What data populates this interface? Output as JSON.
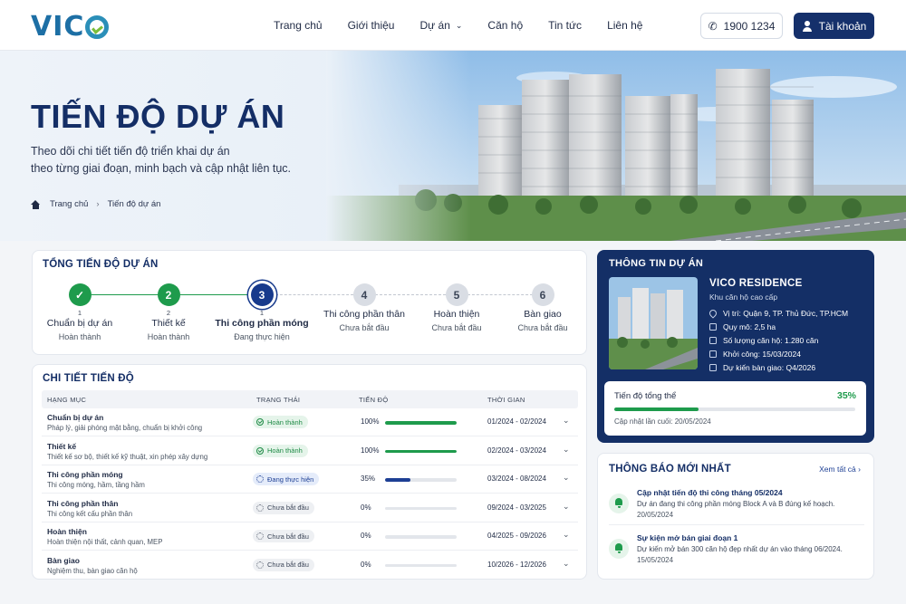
{
  "brand": {
    "logo_text": "VIC"
  },
  "nav": {
    "items": [
      "Trang chủ",
      "Giới thiệu",
      "Dự án",
      "Căn hộ",
      "Tin tức",
      "Liên hệ"
    ],
    "phone": "1900 1234",
    "account": "Tài khoản"
  },
  "hero": {
    "title": "TIẾN ĐỘ DỰ ÁN",
    "subtitle_line1": "Theo dõi chi tiết tiến độ triển khai dự án",
    "subtitle_line2": "theo từng giai đoạn, minh bạch và cập nhật liên tục.",
    "breadcrumb_home": "Trang chủ",
    "breadcrumb_current": "Tiến độ dự án"
  },
  "overall": {
    "title": "TỔNG TIẾN ĐỘ DỰ ÁN",
    "steps": [
      {
        "number": "",
        "sub": "1",
        "label": "Chuẩn bị dự án",
        "status": "Hoàn thành",
        "state": "done"
      },
      {
        "number": "2",
        "sub": "2",
        "label": "Thiết kế",
        "status": "Hoàn thành",
        "state": "done"
      },
      {
        "number": "3",
        "sub": "1",
        "label": "Thi công phần móng",
        "status": "Đang thực hiện",
        "state": "current"
      },
      {
        "number": "4",
        "sub": "",
        "label": "Thi công phần thân",
        "status": "Chưa bắt đầu",
        "state": "pending"
      },
      {
        "number": "5",
        "sub": "",
        "label": "Hoàn thiện",
        "status": "Chưa bắt đầu",
        "state": "pending"
      },
      {
        "number": "6",
        "sub": "",
        "label": "Bàn giao",
        "status": "Chưa bắt đầu",
        "state": "pending"
      }
    ]
  },
  "detail": {
    "title": "CHI TIẾT TIẾN ĐỘ",
    "headers": {
      "item": "HẠNG MỤC",
      "status": "TRẠNG THÁI",
      "progress": "TIẾN ĐỘ",
      "time": "THỜI GIAN"
    },
    "rows": [
      {
        "name": "Chuẩn bị dự án",
        "desc": "Pháp lý, giải phóng mặt bằng, chuẩn bị khởi công",
        "status": "Hoàn thành",
        "state": "done",
        "percent_label": "100%",
        "percent": 100,
        "period": "01/2024 - 02/2024"
      },
      {
        "name": "Thiết kế",
        "desc": "Thiết kế sơ bộ, thiết kế kỹ thuật, xin phép xây dựng",
        "status": "Hoàn thành",
        "state": "done",
        "percent_label": "100%",
        "percent": 100,
        "period": "02/2024 - 03/2024"
      },
      {
        "name": "Thi công phần móng",
        "desc": "Thi công móng, hầm, tầng hầm",
        "status": "Đang thực hiện",
        "state": "current",
        "percent_label": "35%",
        "percent": 35,
        "period": "03/2024 - 08/2024"
      },
      {
        "name": "Thi công phần thân",
        "desc": "Thi công kết cấu phần thân",
        "status": "Chưa bắt đầu",
        "state": "pending",
        "percent_label": "0%",
        "percent": 0,
        "period": "09/2024 - 03/2025"
      },
      {
        "name": "Hoàn thiện",
        "desc": "Hoàn thiện nội thất, cảnh quan, MEP",
        "status": "Chưa bắt đầu",
        "state": "pending",
        "percent_label": "0%",
        "percent": 0,
        "period": "04/2025 - 09/2026"
      },
      {
        "name": "Bàn giao",
        "desc": "Nghiệm thu, bàn giao căn hộ",
        "status": "Chưa bắt đầu",
        "state": "pending",
        "percent_label": "0%",
        "percent": 0,
        "period": "10/2026 - 12/2026"
      }
    ]
  },
  "project": {
    "title": "THÔNG TIN DỰ ÁN",
    "name": "VICO RESIDENCE",
    "type": "Khu căn hộ cao cấp",
    "facts": [
      "Vị trí: Quận 9, TP. Thủ Đức, TP.HCM",
      "Quy mô: 2,5 ha",
      "Số lượng căn hộ: 1.280 căn",
      "Khởi công: 15/03/2024",
      "Dự kiến bàn giao: Q4/2026"
    ],
    "progress_label": "Tiến độ tổng thể",
    "progress_value": "35%",
    "progress_fraction": 0.35,
    "updated": "Cập nhật lần cuối: 20/05/2024"
  },
  "notifications": {
    "title": "THÔNG BÁO MỚI NHẤT",
    "see_all": "Xem tất cả",
    "items": [
      {
        "title": "Cập nhật tiến độ thi công tháng 05/2024",
        "body": "Dự án đang thi công phần móng Block A và B đúng kế hoạch.",
        "date": "20/05/2024"
      },
      {
        "title": "Sự kiện mở bán giai đoạn 1",
        "body": "Dự kiến mở bán 300 căn hộ đẹp nhất dự án vào tháng 06/2024.",
        "date": "15/05/2024"
      }
    ]
  },
  "colors": {
    "navy": "#142f66",
    "green": "#1e9b4c",
    "blue": "#173a8c"
  }
}
